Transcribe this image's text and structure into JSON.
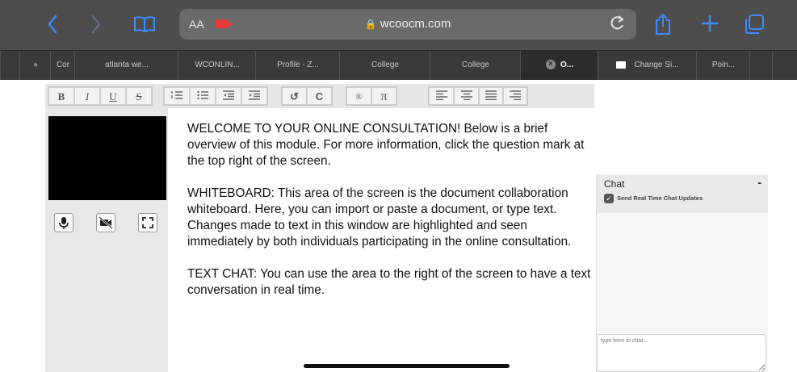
{
  "browser": {
    "aa_label": "AA",
    "url": "wcoocm.com",
    "icons": {
      "back": "chevron-left-icon",
      "forward": "chevron-right-icon",
      "bookmarks": "book-icon",
      "camera": "camera-record-icon",
      "lock": "lock-icon",
      "reload": "reload-icon",
      "share": "share-icon",
      "new_tab": "plus-icon",
      "tabs": "tabs-icon"
    },
    "accent_color": "#3d8bff",
    "record_color": "#e23a3a"
  },
  "tabs": [
    {
      "label": "Cor"
    },
    {
      "label": "atlanta we..."
    },
    {
      "label": "WCONLIN..."
    },
    {
      "label": "Profile - Z..."
    },
    {
      "label": "College"
    },
    {
      "label": "College"
    },
    {
      "label": "O..."
    },
    {
      "label": "Change Si..."
    },
    {
      "label": "Poin..."
    }
  ],
  "toolbar": {
    "bold": "B",
    "italic": "I",
    "underline": "U",
    "strike": "S",
    "undo": "↺",
    "redo": "C",
    "link": "®",
    "pi": "π"
  },
  "whiteboard": {
    "paragraphs": [
      "WELCOME TO YOUR ONLINE CONSULTATION! Below is a brief overview of this module. For more information, click the question mark at the top right of the screen.",
      "WHITEBOARD: This area of the screen is the document collaboration whiteboard. Here, you can import or paste a document, or type text. Changes made to text in this window are highlighted and seen immediately by both individuals participating in the online consultation.",
      "TEXT CHAT: You can use the area to the right of the screen to have a text conversation in real time."
    ]
  },
  "chat": {
    "title": "Chat",
    "minimize": "-",
    "realtime_label": "Send Real Time Chat Updates",
    "input_placeholder": "type here to chat..."
  }
}
